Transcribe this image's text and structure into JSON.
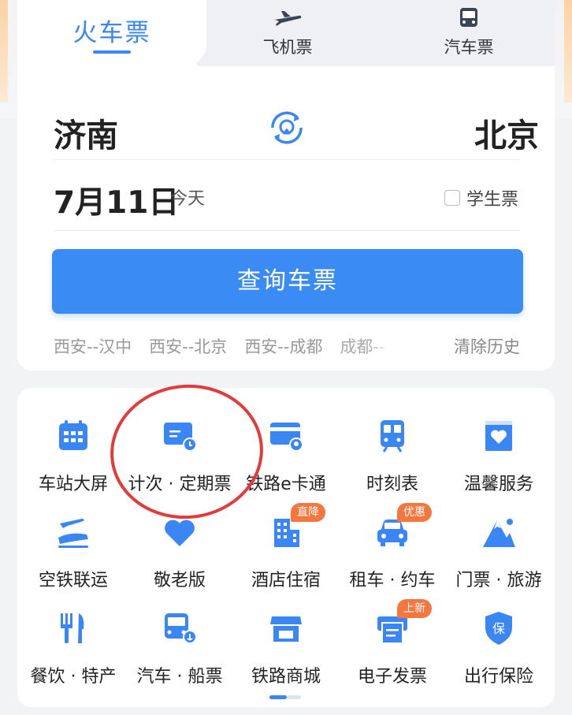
{
  "tabs": [
    {
      "label": "火车票",
      "icon": "train"
    },
    {
      "label": "飞机票",
      "icon": "airplane-icon"
    },
    {
      "label": "汽车票",
      "icon": "bus-icon"
    }
  ],
  "route": {
    "from": "济南",
    "to": "北京",
    "swap_icon": "swap-icon"
  },
  "date": {
    "value": "7月11日",
    "day_hint": "今天"
  },
  "student": {
    "label": "学生票",
    "checked": false
  },
  "search_button": "查询车票",
  "history": [
    "西安--汉中",
    "西安--北京",
    "西安--成都",
    "成都--"
  ],
  "clear_history": "清除历史",
  "services": [
    {
      "label": "车站大屏",
      "icon": "calendar-screen-icon"
    },
    {
      "label": "计次 · 定期票",
      "icon": "card-clock-icon"
    },
    {
      "label": "铁路e卡通",
      "icon": "rail-card-icon"
    },
    {
      "label": "时刻表",
      "icon": "train-timetable-icon"
    },
    {
      "label": "温馨服务",
      "icon": "heart-ticket-icon"
    },
    {
      "label": "空铁联运",
      "icon": "plane-train-icon"
    },
    {
      "label": "敬老版",
      "icon": "heart-icon"
    },
    {
      "label": "酒店住宿",
      "icon": "hotel-icon",
      "badge": "直降"
    },
    {
      "label": "租车 · 约车",
      "icon": "car-icon",
      "badge": "优惠"
    },
    {
      "label": "门票 · 旅游",
      "icon": "mountain-icon"
    },
    {
      "label": "餐饮 · 特产",
      "icon": "fork-knife-icon"
    },
    {
      "label": "汽车 · 船票",
      "icon": "bus-anchor-icon"
    },
    {
      "label": "铁路商城",
      "icon": "store-icon"
    },
    {
      "label": "电子发票",
      "icon": "printer-invoice-icon",
      "badge": "上新"
    },
    {
      "label": "出行保险",
      "icon": "shield-insurance-icon"
    }
  ],
  "colors": {
    "accent": "#3a86f5",
    "badge": "#f4773f",
    "annotation": "#e33b3b"
  }
}
